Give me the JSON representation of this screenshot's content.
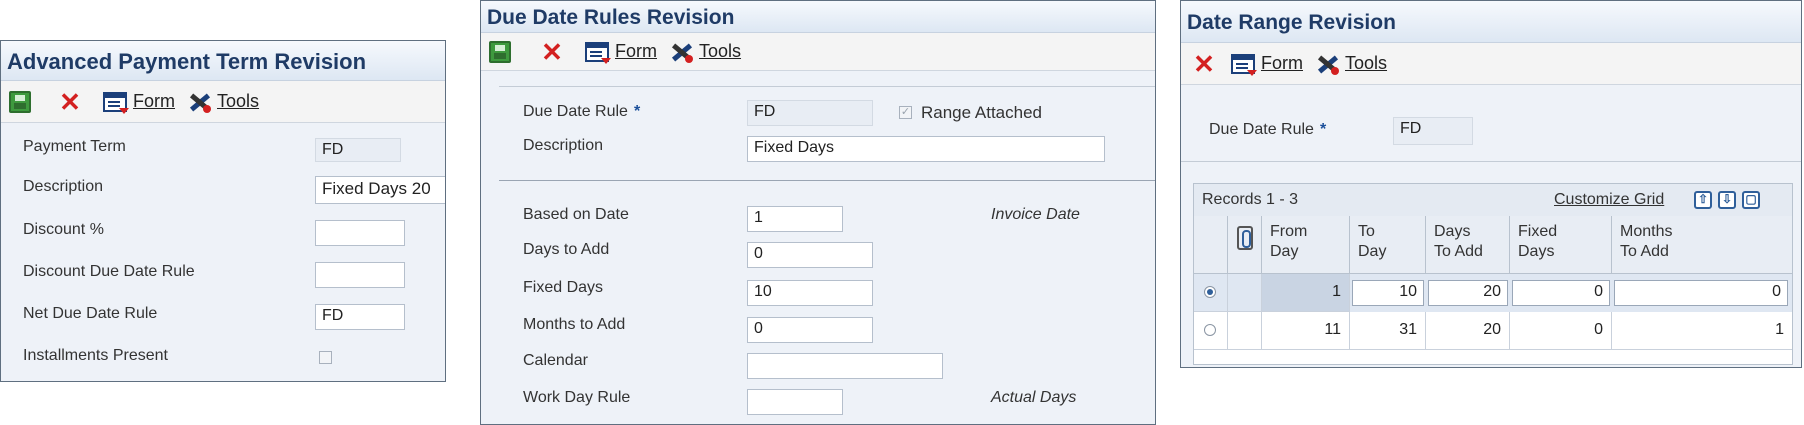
{
  "panel1": {
    "title": "Advanced Payment Term Revision",
    "toolbar": {
      "form_label": "Form",
      "tools_label": "Tools"
    },
    "fields": [
      {
        "label": "Payment Term",
        "value": "FD"
      },
      {
        "label": "Description",
        "value": "Fixed Days 20"
      },
      {
        "label": "Discount %",
        "value": ""
      },
      {
        "label": "Discount Due Date Rule",
        "value": ""
      },
      {
        "label": "Net Due Date Rule",
        "value": "FD"
      },
      {
        "label": "Installments Present",
        "value": ""
      }
    ]
  },
  "panel2": {
    "title": "Due Date Rules Revision",
    "toolbar": {
      "form_label": "Form",
      "tools_label": "Tools"
    },
    "due_date_rule_label": "Due Date Rule",
    "required_marker": "*",
    "due_date_rule_value": "FD",
    "range_attached_label": "Range Attached",
    "description_label": "Description",
    "description_value": "Fixed Days",
    "based_on_date_label": "Based on Date",
    "based_on_date_value": "1",
    "based_on_date_desc": "Invoice Date",
    "days_to_add_label": "Days to Add",
    "days_to_add_value": "0",
    "fixed_days_label": "Fixed Days",
    "fixed_days_value": "10",
    "months_to_add_label": "Months to Add",
    "months_to_add_value": "0",
    "calendar_label": "Calendar",
    "calendar_value": "",
    "work_day_rule_label": "Work Day Rule",
    "work_day_rule_value": "",
    "work_day_rule_desc": "Actual Days"
  },
  "panel3": {
    "title": "Date Range Revision",
    "toolbar": {
      "form_label": "Form",
      "tools_label": "Tools"
    },
    "due_date_rule_label": "Due Date Rule",
    "required_marker": "*",
    "due_date_rule_value": "FD",
    "records_label": "Records 1 - 3",
    "customize_grid_label": "Customize Grid",
    "columns": [
      {
        "line1": "From",
        "line2": "Day"
      },
      {
        "line1": "To",
        "line2": "Day"
      },
      {
        "line1": "Days",
        "line2": "To Add"
      },
      {
        "line1": "Fixed",
        "line2": "Days"
      },
      {
        "line1": "Months",
        "line2": "To Add"
      }
    ],
    "rows": [
      {
        "from_day": "1",
        "to_day": "10",
        "days_to_add": "20",
        "fixed_days": "0",
        "months_to_add": "0",
        "selected": true
      },
      {
        "from_day": "11",
        "to_day": "31",
        "days_to_add": "20",
        "fixed_days": "0",
        "months_to_add": "1",
        "selected": false
      }
    ]
  }
}
